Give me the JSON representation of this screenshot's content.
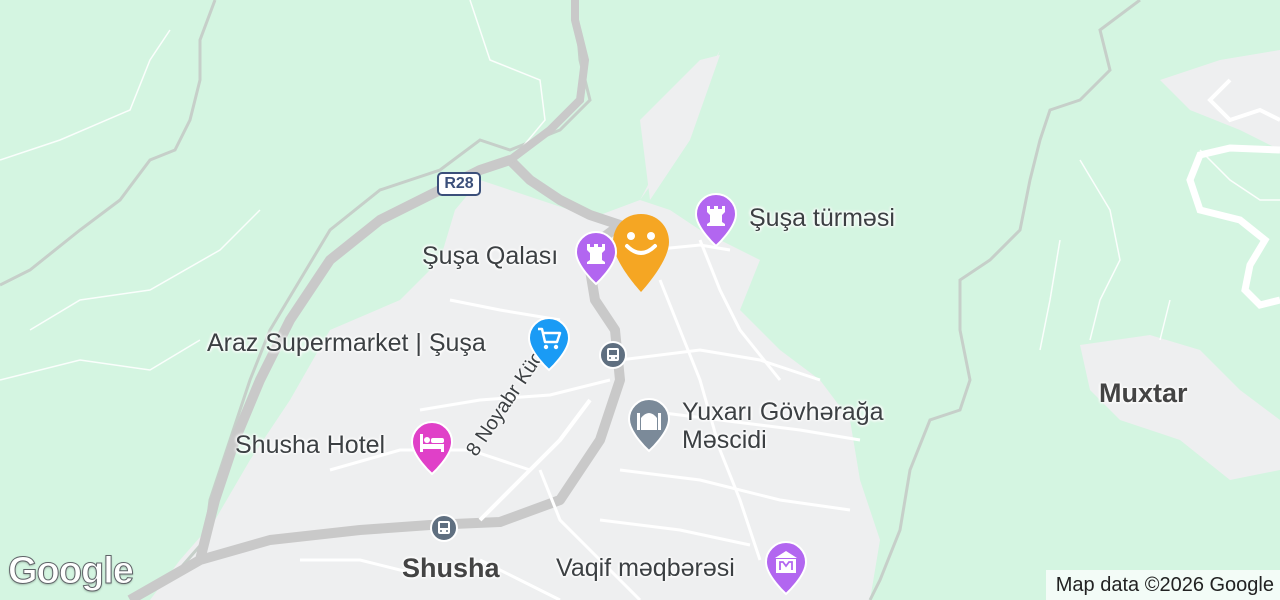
{
  "map": {
    "road_shield": "R28",
    "street_label": "8 Noyabr Küçəsi",
    "places": {
      "susa_qalasi": "Şuşa Qalası",
      "susa_turmesi": "Şuşa türməsi",
      "araz": "Araz Supermarket | Şuşa",
      "yuxari_line1": "Yuxarı Gövhərağa",
      "yuxari_line2": "Məscidi",
      "shusha_hotel": "Shusha Hotel",
      "vaqif": "Vaqif məqbərəsi",
      "shusha_town": "Shusha",
      "muxtar": "Muxtar"
    },
    "icons": {
      "current_location": "smiley-location-marker-icon",
      "castle": "castle-icon",
      "tower": "castle-icon",
      "shopping": "shopping-cart-icon",
      "mosque": "mosque-icon",
      "hotel": "bed-icon",
      "museum": "monument-icon",
      "bus": "bus-icon"
    },
    "colors": {
      "land": "#d4f5e1",
      "urban": "#eeefee",
      "road": "#c9c9c9",
      "historic_pin": "#b266f0",
      "shopping_pin": "#1a9bf5",
      "hotel_pin": "#e040c8",
      "mosque_pin": "#7b8a99",
      "marker": "#f5a623"
    },
    "logo": "Google",
    "attribution": "Map data ©2026 Google"
  }
}
